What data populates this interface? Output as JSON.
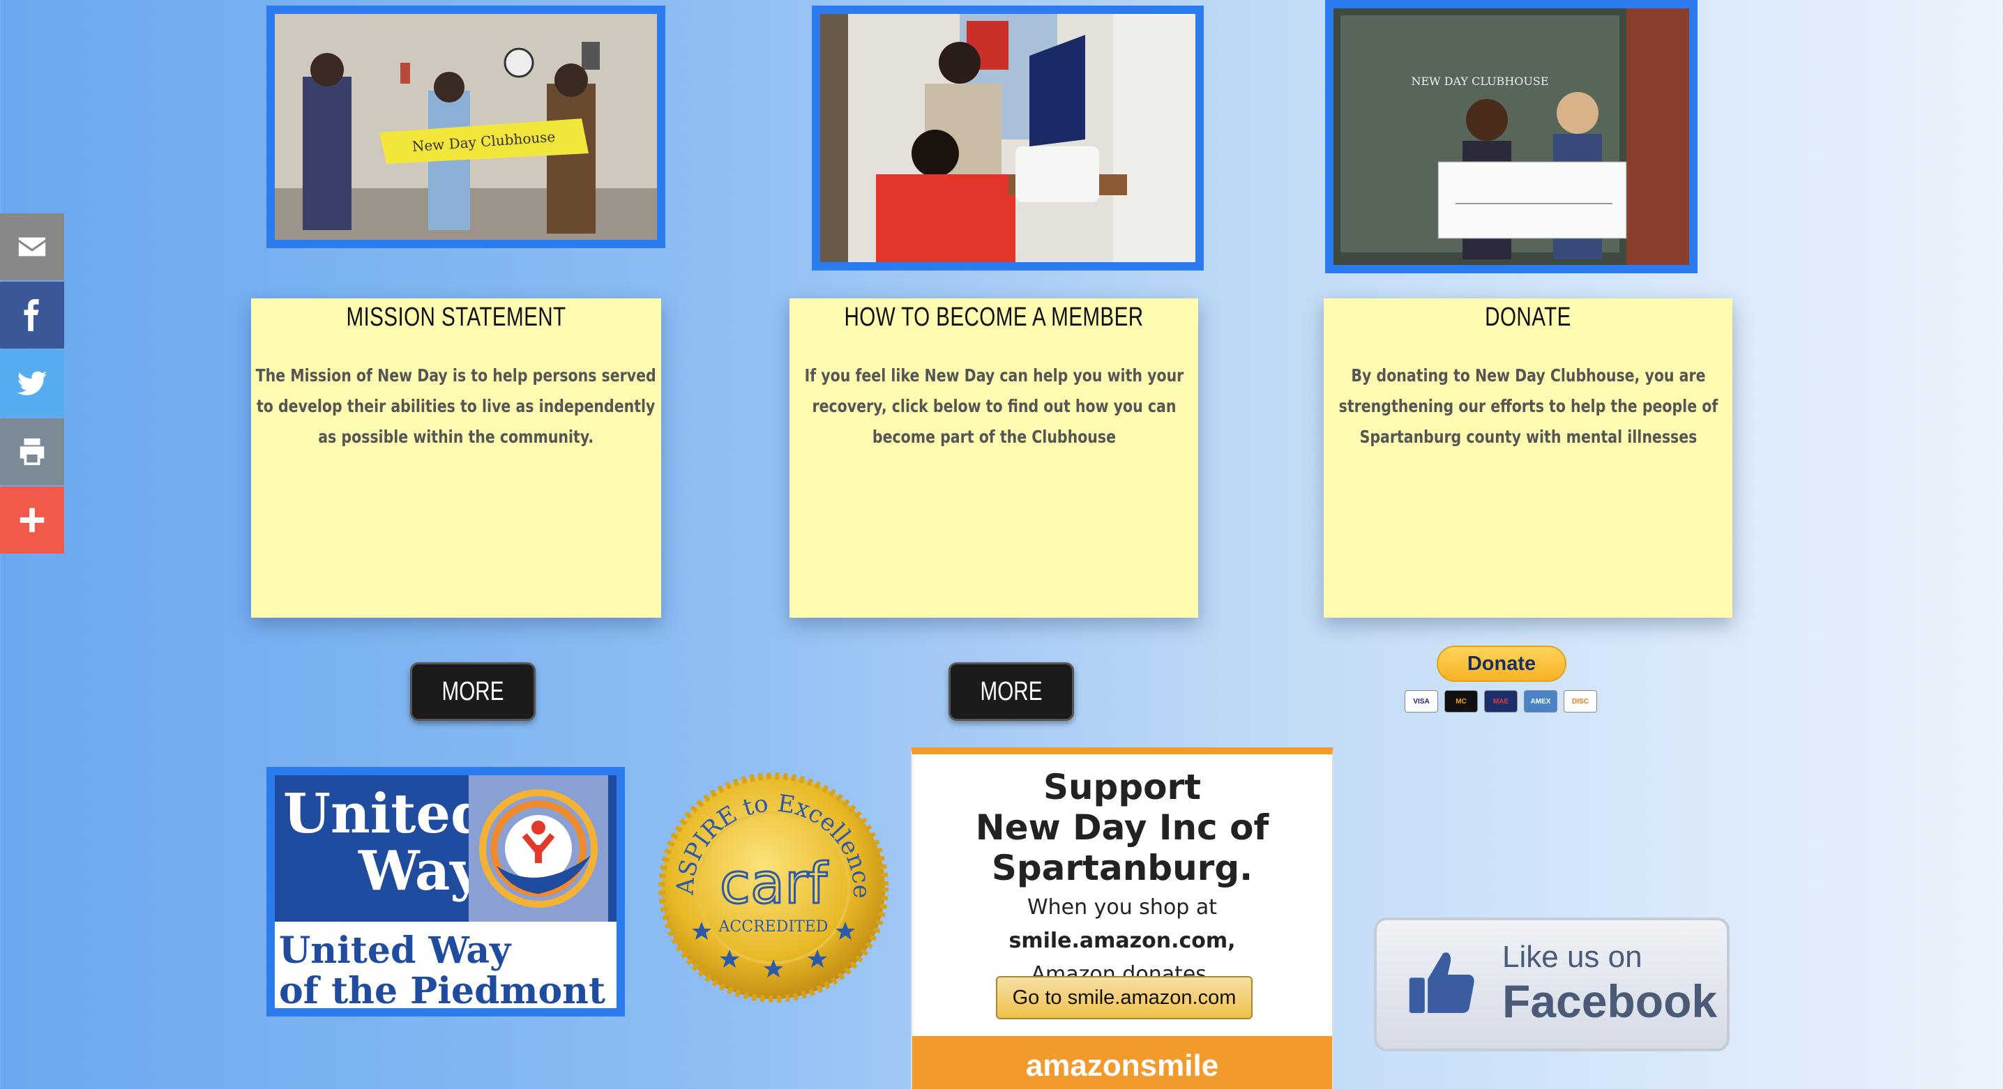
{
  "share_bar": {
    "items": [
      {
        "name": "email",
        "color": "#888888"
      },
      {
        "name": "facebook",
        "color": "#3b5998"
      },
      {
        "name": "twitter",
        "color": "#55acee"
      },
      {
        "name": "print",
        "color": "#7a8b96"
      },
      {
        "name": "more",
        "color": "#f05a4a"
      }
    ]
  },
  "cards": [
    {
      "title": "MISSION STATEMENT",
      "body": "The Mission of New Day is to help persons served to develop their abilities to live as independently as possible within the community."
    },
    {
      "title": "HOW TO BECOME A MEMBER",
      "body": "If you feel like New Day can help you with your recovery, click below to find out how you can become part of the Clubhouse"
    },
    {
      "title": "DONATE",
      "body": "By donating to New Day Clubhouse, you are strengthening our efforts to help the people of Spartanburg county with mental illnesses"
    }
  ],
  "buttons": {
    "more_1": "MORE",
    "more_2": "MORE",
    "donate": "Donate"
  },
  "payment_cards": [
    "VISA",
    "MC",
    "MAE",
    "AMEX",
    "DISC"
  ],
  "photos": {
    "banner_text": "New Day Clubhouse",
    "clubhouse_sign": "NEW DAY CLUBHOUSE"
  },
  "united_way": {
    "line1": "United",
    "line2": "Way",
    "bottom1": "United Way",
    "bottom2": "of the Piedmont"
  },
  "carf": {
    "arc": "ASPIRE to Excellence",
    "name": "carf",
    "accredited": "ACCREDITED"
  },
  "amazon": {
    "heading1": "Support",
    "heading2": "New Day Inc of",
    "heading3": "Spartanburg.",
    "line1_pre": "When you shop at ",
    "line1_bold": "smile.amazon.com,",
    "line2": "Amazon donates.",
    "button": "Go to smile.amazon.com",
    "footer": "amazonsmile"
  },
  "facebook_like": {
    "line1": "Like us on",
    "line2": "Facebook"
  },
  "colors": {
    "accent_blue": "#2c7cf0",
    "card_yellow": "#fffbb0",
    "button_dark": "#1b1b1b"
  }
}
